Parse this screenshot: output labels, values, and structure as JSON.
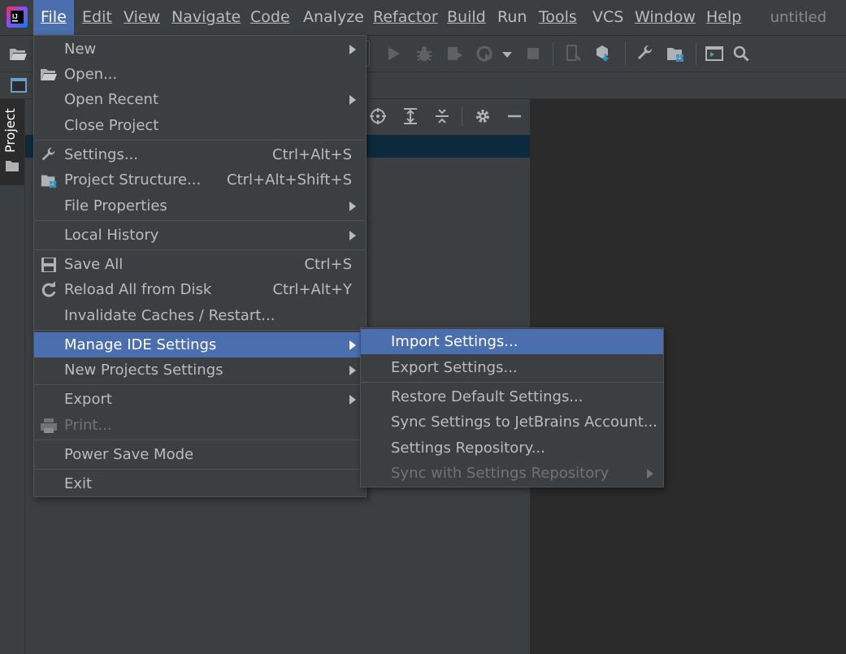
{
  "window_title": "untitled",
  "menubar": {
    "items": [
      {
        "label": "File"
      },
      {
        "label": "Edit"
      },
      {
        "label": "View"
      },
      {
        "label": "Navigate"
      },
      {
        "label": "Code"
      },
      {
        "label": "Analyze"
      },
      {
        "label": "Refactor"
      },
      {
        "label": "Build"
      },
      {
        "label": "Run"
      },
      {
        "label": "Tools"
      },
      {
        "label": "VCS"
      },
      {
        "label": "Window"
      },
      {
        "label": "Help"
      }
    ]
  },
  "tool_window": {
    "project_tab_label": "Project"
  },
  "file_menu": {
    "items": [
      {
        "label": "New",
        "shortcut": "",
        "submenu": true
      },
      {
        "label": "Open...",
        "shortcut": ""
      },
      {
        "label": "Open Recent",
        "shortcut": "",
        "submenu": true
      },
      {
        "label": "Close Project",
        "shortcut": ""
      },
      {
        "label": "Settings...",
        "shortcut": "Ctrl+Alt+S"
      },
      {
        "label": "Project Structure...",
        "shortcut": "Ctrl+Alt+Shift+S"
      },
      {
        "label": "File Properties",
        "shortcut": "",
        "submenu": true
      },
      {
        "label": "Local History",
        "shortcut": "",
        "submenu": true
      },
      {
        "label": "Save All",
        "shortcut": "Ctrl+S"
      },
      {
        "label": "Reload All from Disk",
        "shortcut": "Ctrl+Alt+Y"
      },
      {
        "label": "Invalidate Caches / Restart...",
        "shortcut": ""
      },
      {
        "label": "Manage IDE Settings",
        "shortcut": "",
        "submenu": true,
        "selected": true
      },
      {
        "label": "New Projects Settings",
        "shortcut": "",
        "submenu": true
      },
      {
        "label": "Export",
        "shortcut": "",
        "submenu": true
      },
      {
        "label": "Print...",
        "shortcut": "",
        "disabled": true
      },
      {
        "label": "Power Save Mode",
        "shortcut": ""
      },
      {
        "label": "Exit",
        "shortcut": ""
      }
    ]
  },
  "manage_ide_settings_submenu": {
    "items": [
      {
        "label": "Import Settings...",
        "selected": true
      },
      {
        "label": "Export Settings..."
      },
      {
        "label": "Restore Default Settings..."
      },
      {
        "label": "Sync Settings to JetBrains Account..."
      },
      {
        "label": "Settings Repository..."
      },
      {
        "label": "Sync with Settings Repository",
        "disabled": true,
        "submenu": true
      }
    ]
  },
  "colors": {
    "background": "#3c3f41",
    "editor": "#2b2b2b",
    "selection": "#4b6eaf",
    "tree_selection": "#0d293e",
    "text": "#bbbbbb",
    "disabled_text": "#6f7376"
  }
}
